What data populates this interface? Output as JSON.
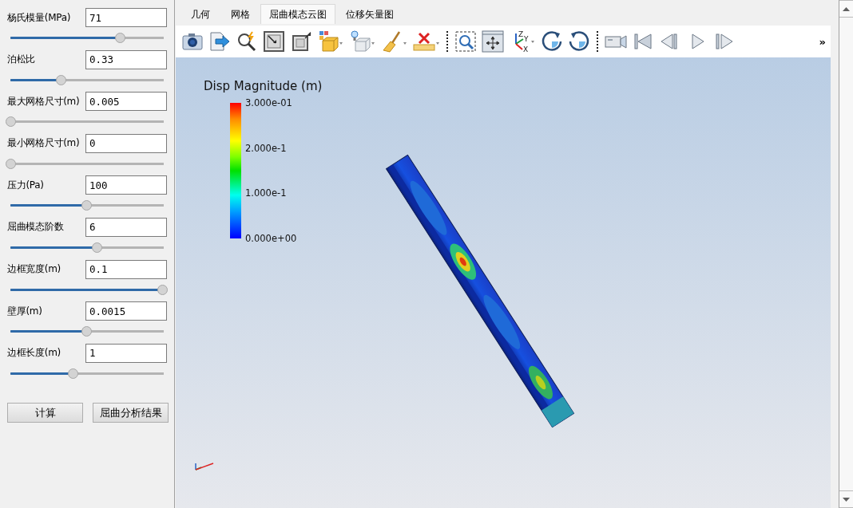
{
  "parameters": [
    {
      "label": "杨氏模量(MPa)",
      "value": "71",
      "level": 0.72
    },
    {
      "label": "泊松比",
      "value": "0.33",
      "level": 0.33
    },
    {
      "label": "最大网格尺寸(m)",
      "value": "0.005",
      "level": 0
    },
    {
      "label": "最小网格尺寸(m)",
      "value": "0",
      "level": 0
    },
    {
      "label": "压力(Pa)",
      "value": "100",
      "level": 0.5
    },
    {
      "label": "屈曲模态阶数",
      "value": "6",
      "level": 0.57
    },
    {
      "label": "边框宽度(m)",
      "value": "0.1",
      "level": 1
    },
    {
      "label": "壁厚(m)",
      "value": "0.0015",
      "level": 0.5
    },
    {
      "label": "边框长度(m)",
      "value": "1",
      "level": 0.41
    }
  ],
  "buttons": [
    "计算",
    "屈曲分析结果"
  ],
  "tabs": [
    {
      "label": "几何",
      "selected": false
    },
    {
      "label": "网格",
      "selected": false
    },
    {
      "label": "屈曲模态云图",
      "selected": true
    },
    {
      "label": "位移矢量图",
      "selected": false
    }
  ],
  "toolbar": {
    "axis_labels": [
      "Z",
      "Y",
      "X"
    ],
    "overflow": "»"
  },
  "legend": {
    "title": "Disp Magnitude (m)",
    "ticks": [
      "3.000e-01",
      "2.000e-1",
      "1.000e-1",
      "0.000e+00"
    ]
  }
}
